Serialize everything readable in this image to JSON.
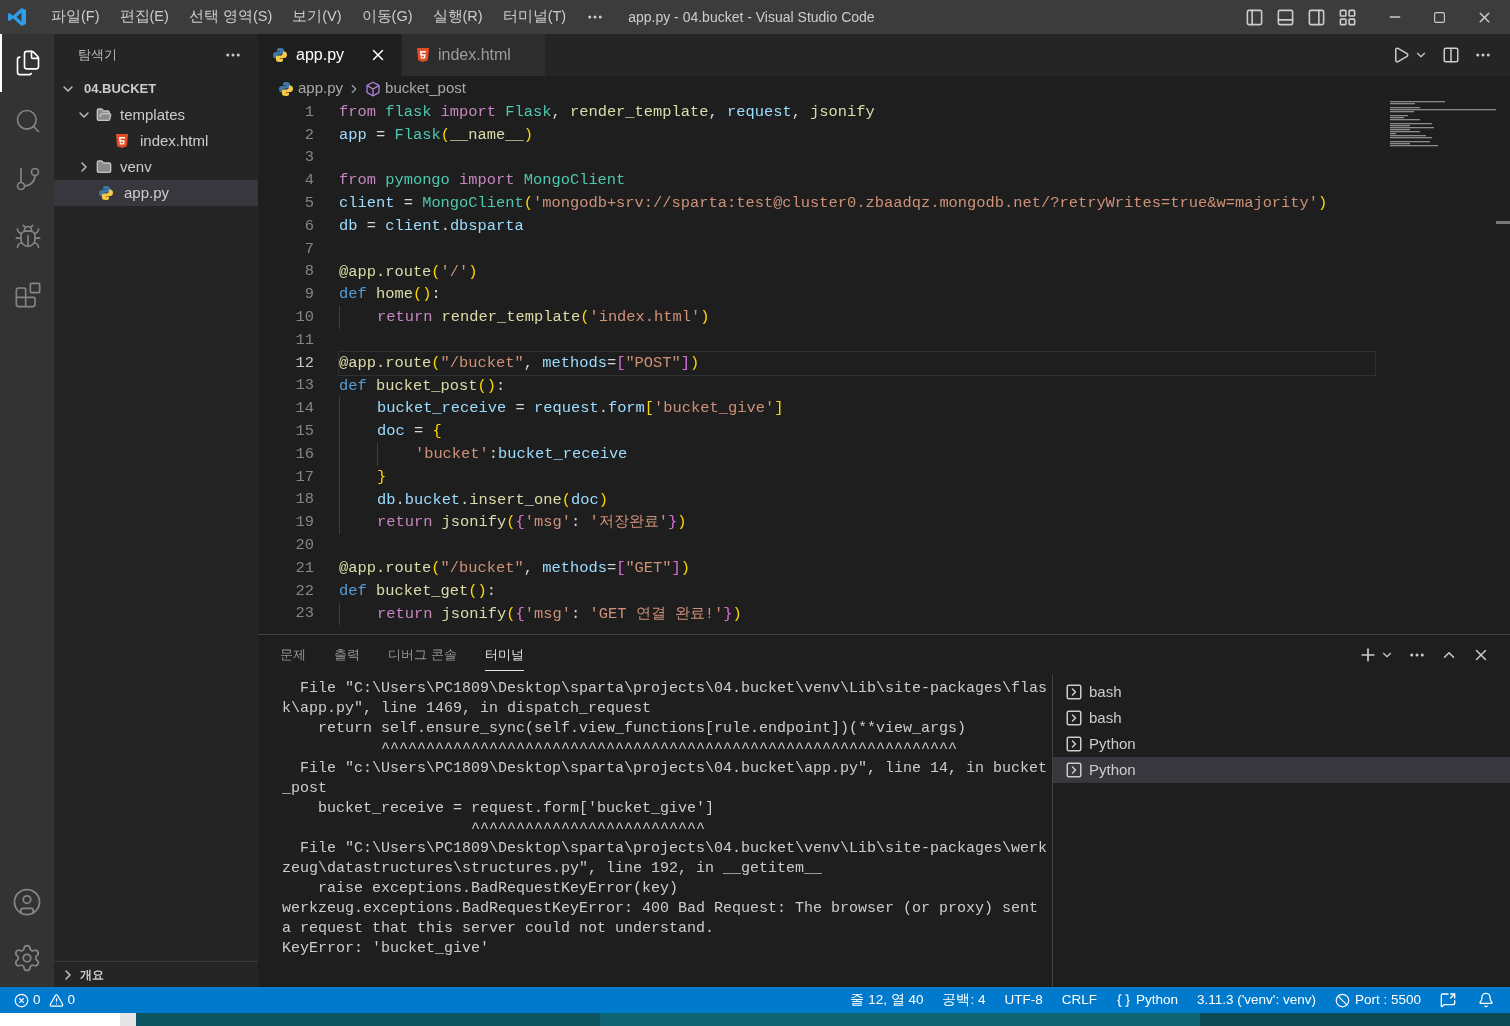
{
  "title_bar": {
    "menus": [
      "파일(F)",
      "편집(E)",
      "선택 영역(S)",
      "보기(V)",
      "이동(G)",
      "실행(R)",
      "터미널(T)"
    ],
    "title": "app.py - 04.bucket - Visual Studio Code"
  },
  "activity_bar": [
    {
      "kind": "files",
      "selected": true
    },
    {
      "kind": "search",
      "selected": false
    },
    {
      "kind": "source-control",
      "selected": false
    },
    {
      "kind": "run-debug",
      "selected": false
    },
    {
      "kind": "extensions",
      "selected": false
    }
  ],
  "sidebar": {
    "title": "탐색기",
    "tree": [
      {
        "label": "04.BUCKET",
        "kind": "root",
        "expanded": true,
        "selected": false,
        "children": [
          {
            "label": "templates",
            "kind": "folder",
            "expanded": true,
            "selected": false,
            "children": [
              {
                "label": "index.html",
                "kind": "html",
                "selected": false
              }
            ]
          },
          {
            "label": "venv",
            "kind": "folder",
            "expanded": false,
            "selected": false
          },
          {
            "label": "app.py",
            "kind": "python",
            "selected": true
          }
        ]
      }
    ],
    "outline": {
      "label": "개요",
      "expanded": false
    }
  },
  "tabs": [
    {
      "label": "app.py",
      "kind": "python",
      "selected": true
    },
    {
      "label": "index.html",
      "kind": "html",
      "selected": false
    }
  ],
  "breadcrumb": [
    {
      "label": "app.py",
      "kind": "python"
    },
    {
      "label": "bucket_post",
      "kind": "symbol"
    }
  ],
  "code_lines": [
    {
      "number": "1",
      "current": false,
      "tokens": [
        {
          "kind": "kw",
          "text": "from "
        },
        {
          "kind": "mod",
          "text": "flask "
        },
        {
          "kind": "kw",
          "text": "import "
        },
        {
          "kind": "mod",
          "text": "Flask"
        },
        {
          "kind": "p",
          "text": ", "
        },
        {
          "kind": "fn",
          "text": "render_template"
        },
        {
          "kind": "p",
          "text": ", "
        },
        {
          "kind": "var",
          "text": "request"
        },
        {
          "kind": "p",
          "text": ", "
        },
        {
          "kind": "fn",
          "text": "jsonify"
        }
      ]
    },
    {
      "number": "2",
      "current": false,
      "tokens": [
        {
          "kind": "var",
          "text": "app"
        },
        {
          "kind": "p",
          "text": " = "
        },
        {
          "kind": "mod",
          "text": "Flask"
        },
        {
          "kind": "b1",
          "text": "("
        },
        {
          "kind": "fn",
          "text": "__name__"
        },
        {
          "kind": "b1",
          "text": ")"
        }
      ]
    },
    {
      "number": "3",
      "current": false
    },
    {
      "number": "4",
      "current": false,
      "tokens": [
        {
          "kind": "kw",
          "text": "from "
        },
        {
          "kind": "mod",
          "text": "pymongo "
        },
        {
          "kind": "kw",
          "text": "import "
        },
        {
          "kind": "mod",
          "text": "MongoClient"
        }
      ]
    },
    {
      "number": "5",
      "current": false,
      "tokens": [
        {
          "kind": "var",
          "text": "client"
        },
        {
          "kind": "p",
          "text": " = "
        },
        {
          "kind": "mod",
          "text": "MongoClient"
        },
        {
          "kind": "b1",
          "text": "("
        },
        {
          "kind": "str",
          "text": "'mongodb+srv://sparta:test@cluster0.zbaadqz.mongodb.net/?retryWrites=true&w=majority'"
        },
        {
          "kind": "b1",
          "text": ")"
        }
      ]
    },
    {
      "number": "6",
      "current": false,
      "tokens": [
        {
          "kind": "var",
          "text": "db"
        },
        {
          "kind": "p",
          "text": " = "
        },
        {
          "kind": "var",
          "text": "client"
        },
        {
          "kind": "p",
          "text": "."
        },
        {
          "kind": "var",
          "text": "dbsparta"
        }
      ]
    },
    {
      "number": "7",
      "current": false
    },
    {
      "number": "8",
      "current": false,
      "tokens": [
        {
          "kind": "fn",
          "text": "@app.route"
        },
        {
          "kind": "b1",
          "text": "("
        },
        {
          "kind": "str",
          "text": "'/'"
        },
        {
          "kind": "b1",
          "text": ")"
        }
      ]
    },
    {
      "number": "9",
      "current": false,
      "tokens": [
        {
          "kind": "def",
          "text": "def "
        },
        {
          "kind": "fn",
          "text": "home"
        },
        {
          "kind": "b1",
          "text": "()"
        },
        {
          "kind": "p",
          "text": ":"
        }
      ]
    },
    {
      "number": "10",
      "current": false,
      "tokens": [
        {
          "kind": "kw",
          "text": "    return "
        },
        {
          "kind": "fn",
          "text": "render_template"
        },
        {
          "kind": "b1",
          "text": "("
        },
        {
          "kind": "str",
          "text": "'index.html'"
        },
        {
          "kind": "b1",
          "text": ")"
        }
      ]
    },
    {
      "number": "11",
      "current": false
    },
    {
      "number": "12",
      "current": true,
      "tokens": [
        {
          "kind": "fn",
          "text": "@app.route"
        },
        {
          "kind": "b1",
          "text": "("
        },
        {
          "kind": "str",
          "text": "\"/bucket\""
        },
        {
          "kind": "p",
          "text": ", "
        },
        {
          "kind": "var",
          "text": "methods"
        },
        {
          "kind": "p",
          "text": "="
        },
        {
          "kind": "b2",
          "text": "["
        },
        {
          "kind": "str",
          "text": "\"POST\""
        },
        {
          "kind": "b2",
          "text": "]"
        },
        {
          "kind": "b1",
          "text": ")"
        }
      ]
    },
    {
      "number": "13",
      "current": false,
      "tokens": [
        {
          "kind": "def",
          "text": "def "
        },
        {
          "kind": "fn",
          "text": "bucket_post"
        },
        {
          "kind": "b1",
          "text": "()"
        },
        {
          "kind": "p",
          "text": ":"
        }
      ]
    },
    {
      "number": "14",
      "current": false,
      "tokens": [
        {
          "kind": "var",
          "text": "    bucket_receive"
        },
        {
          "kind": "p",
          "text": " = "
        },
        {
          "kind": "var",
          "text": "request"
        },
        {
          "kind": "p",
          "text": "."
        },
        {
          "kind": "var",
          "text": "form"
        },
        {
          "kind": "b1",
          "text": "["
        },
        {
          "kind": "str",
          "text": "'bucket_give'"
        },
        {
          "kind": "b1",
          "text": "]"
        }
      ]
    },
    {
      "number": "15",
      "current": false,
      "tokens": [
        {
          "kind": "var",
          "text": "    doc"
        },
        {
          "kind": "p",
          "text": " = "
        },
        {
          "kind": "b1",
          "text": "{"
        }
      ]
    },
    {
      "number": "16",
      "current": false,
      "tokens": [
        {
          "kind": "str",
          "text": "        'bucket'"
        },
        {
          "kind": "p",
          "text": ":"
        },
        {
          "kind": "var",
          "text": "bucket_receive"
        }
      ]
    },
    {
      "number": "17",
      "current": false,
      "tokens": [
        {
          "kind": "b1",
          "text": "    }"
        }
      ]
    },
    {
      "number": "18",
      "current": false,
      "tokens": [
        {
          "kind": "var",
          "text": "    db"
        },
        {
          "kind": "p",
          "text": "."
        },
        {
          "kind": "var",
          "text": "bucket"
        },
        {
          "kind": "p",
          "text": "."
        },
        {
          "kind": "fn",
          "text": "insert_one"
        },
        {
          "kind": "b1",
          "text": "("
        },
        {
          "kind": "var",
          "text": "doc"
        },
        {
          "kind": "b1",
          "text": ")"
        }
      ]
    },
    {
      "number": "19",
      "current": false,
      "tokens": [
        {
          "kind": "kw",
          "text": "    return "
        },
        {
          "kind": "fn",
          "text": "jsonify"
        },
        {
          "kind": "b1",
          "text": "("
        },
        {
          "kind": "b2",
          "text": "{"
        },
        {
          "kind": "str",
          "text": "'msg'"
        },
        {
          "kind": "p",
          "text": ": "
        },
        {
          "kind": "str",
          "text": "'저장완료'"
        },
        {
          "kind": "b2",
          "text": "}"
        },
        {
          "kind": "b1",
          "text": ")"
        }
      ]
    },
    {
      "number": "20",
      "current": false
    },
    {
      "number": "21",
      "current": false,
      "tokens": [
        {
          "kind": "fn",
          "text": "@app.route"
        },
        {
          "kind": "b1",
          "text": "("
        },
        {
          "kind": "str",
          "text": "\"/bucket\""
        },
        {
          "kind": "p",
          "text": ", "
        },
        {
          "kind": "var",
          "text": "methods"
        },
        {
          "kind": "p",
          "text": "="
        },
        {
          "kind": "b2",
          "text": "["
        },
        {
          "kind": "str",
          "text": "\"GET\""
        },
        {
          "kind": "b2",
          "text": "]"
        },
        {
          "kind": "b1",
          "text": ")"
        }
      ]
    },
    {
      "number": "22",
      "current": false,
      "tokens": [
        {
          "kind": "def",
          "text": "def "
        },
        {
          "kind": "fn",
          "text": "bucket_get"
        },
        {
          "kind": "b1",
          "text": "()"
        },
        {
          "kind": "p",
          "text": ":"
        }
      ]
    },
    {
      "number": "23",
      "current": false,
      "tokens": [
        {
          "kind": "kw",
          "text": "    return "
        },
        {
          "kind": "fn",
          "text": "jsonify"
        },
        {
          "kind": "b1",
          "text": "("
        },
        {
          "kind": "b2",
          "text": "{"
        },
        {
          "kind": "str",
          "text": "'msg'"
        },
        {
          "kind": "p",
          "text": ": "
        },
        {
          "kind": "str",
          "text": "'GET 연결 완료!'"
        },
        {
          "kind": "b2",
          "text": "}"
        },
        {
          "kind": "b1",
          "text": ")"
        }
      ]
    }
  ],
  "panel": {
    "tabs": [
      {
        "label": "문제",
        "selected": false
      },
      {
        "label": "출력",
        "selected": false
      },
      {
        "label": "디버그 콘솔",
        "selected": false
      },
      {
        "label": "터미널",
        "selected": true
      }
    ],
    "terminal_lines": [
      "  File \"C:\\Users\\PC1809\\Desktop\\sparta\\projects\\04.bucket\\venv\\Lib\\site-packages\\flas",
      "k\\app.py\", line 1469, in dispatch_request",
      "    return self.ensure_sync(self.view_functions[rule.endpoint])(**view_args)",
      "           ^^^^^^^^^^^^^^^^^^^^^^^^^^^^^^^^^^^^^^^^^^^^^^^^^^^^^^^^^^^^^^^^",
      "  File \"c:\\Users\\PC1809\\Desktop\\sparta\\projects\\04.bucket\\app.py\", line 14, in bucket",
      "_post",
      "    bucket_receive = request.form['bucket_give']",
      "                     ^^^^^^^^^^^^^^^^^^^^^^^^^^",
      "  File \"C:\\Users\\PC1809\\Desktop\\sparta\\projects\\04.bucket\\venv\\Lib\\site-packages\\werk",
      "zeug\\datastructures\\structures.py\", line 192, in __getitem__",
      "    raise exceptions.BadRequestKeyError(key)",
      "werkzeug.exceptions.BadRequestKeyError: 400 Bad Request: The browser (or proxy) sent",
      "a request that this server could not understand.",
      "KeyError: 'bucket_give'"
    ],
    "terminals": [
      {
        "label": "bash",
        "selected": false
      },
      {
        "label": "bash",
        "selected": false
      },
      {
        "label": "Python",
        "selected": false
      },
      {
        "label": "Python",
        "selected": true
      }
    ]
  },
  "status_bar": {
    "errors": "0",
    "warnings": "0",
    "items": [
      {
        "kind": "text",
        "text": "줄 12, 열 40"
      },
      {
        "kind": "text",
        "text": "공백: 4"
      },
      {
        "kind": "text",
        "text": "UTF-8"
      },
      {
        "kind": "text",
        "text": "CRLF"
      },
      {
        "kind": "language",
        "text": "Python"
      },
      {
        "kind": "text",
        "text": "3.11.3 ('venv': venv)"
      },
      {
        "kind": "port",
        "text": "Port : 5500"
      }
    ]
  }
}
